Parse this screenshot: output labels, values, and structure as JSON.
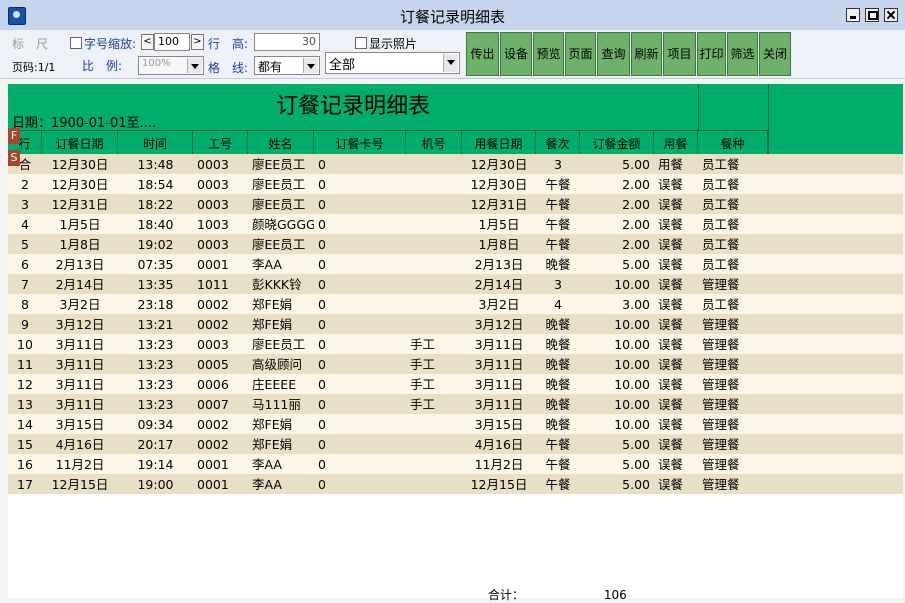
{
  "window": {
    "title": "订餐记录明细表"
  },
  "toolbar": {
    "ruler_label": "标　尺",
    "font_scale_label": "字号缩放:",
    "font_scale_value": "100",
    "row_label": "行",
    "height_label": "高:",
    "height_value": "30",
    "show_photo_label": "显示照片",
    "page_label": "页码:1/1",
    "ratio_label": "比　例:",
    "ratio_value": "100%",
    "grid_label": "格　线:",
    "grid_value": "都有",
    "scope_value": "全部",
    "buttons": [
      "传出",
      "设备",
      "预览",
      "页面",
      "查询",
      "刷新",
      "项目",
      "打印",
      "筛选",
      "关闭"
    ]
  },
  "report": {
    "title": "订餐记录明细表",
    "date_range": "日期：1900-01-01至....",
    "badges": [
      "F",
      "S"
    ],
    "columns": [
      "行",
      "订餐日期",
      "时间",
      "工号",
      "姓名",
      "订餐卡号",
      "机号",
      "用餐日期",
      "餐次",
      "订餐金额",
      "用餐",
      "餐种"
    ],
    "rows": [
      [
        "合",
        "12月30日",
        "13:48",
        "0003",
        "廖EE员工",
        "0",
        "",
        "12月30日",
        "3",
        "5.00",
        "用餐",
        "员工餐"
      ],
      [
        "2",
        "12月30日",
        "18:54",
        "0003",
        "廖EE员工",
        "0",
        "",
        "12月30日",
        "午餐",
        "2.00",
        "误餐",
        "员工餐"
      ],
      [
        "3",
        "12月31日",
        "18:22",
        "0003",
        "廖EE员工",
        "0",
        "",
        "12月31日",
        "午餐",
        "2.00",
        "误餐",
        "员工餐"
      ],
      [
        "4",
        "1月5日",
        "18:40",
        "1003",
        "颜晓GGGG",
        "0",
        "",
        "1月5日",
        "午餐",
        "2.00",
        "误餐",
        "员工餐"
      ],
      [
        "5",
        "1月8日",
        "19:02",
        "0003",
        "廖EE员工",
        "0",
        "",
        "1月8日",
        "午餐",
        "2.00",
        "误餐",
        "员工餐"
      ],
      [
        "6",
        "2月13日",
        "07:35",
        "0001",
        "李AA",
        "0",
        "",
        "2月13日",
        "晚餐",
        "5.00",
        "误餐",
        "员工餐"
      ],
      [
        "7",
        "2月14日",
        "13:35",
        "1011",
        "彭KKK铃",
        "0",
        "",
        "2月14日",
        "3",
        "10.00",
        "误餐",
        "管理餐"
      ],
      [
        "8",
        "3月2日",
        "23:18",
        "0002",
        "郑FE娟",
        "0",
        "",
        "3月2日",
        "4",
        "3.00",
        "误餐",
        "员工餐"
      ],
      [
        "9",
        "3月12日",
        "13:21",
        "0002",
        "郑FE娟",
        "0",
        "",
        "3月12日",
        "晚餐",
        "10.00",
        "误餐",
        "管理餐"
      ],
      [
        "10",
        "3月11日",
        "13:23",
        "0003",
        "廖EE员工",
        "0",
        "手工",
        "3月11日",
        "晚餐",
        "10.00",
        "误餐",
        "管理餐"
      ],
      [
        "11",
        "3月11日",
        "13:23",
        "0005",
        "高级顾问",
        "0",
        "手工",
        "3月11日",
        "晚餐",
        "10.00",
        "误餐",
        "管理餐"
      ],
      [
        "12",
        "3月11日",
        "13:23",
        "0006",
        "庄EEEE",
        "0",
        "手工",
        "3月11日",
        "晚餐",
        "10.00",
        "误餐",
        "管理餐"
      ],
      [
        "13",
        "3月11日",
        "13:23",
        "0007",
        "马111丽",
        "0",
        "手工",
        "3月11日",
        "晚餐",
        "10.00",
        "误餐",
        "管理餐"
      ],
      [
        "14",
        "3月15日",
        "09:34",
        "0002",
        "郑FE娟",
        "0",
        "",
        "3月15日",
        "晚餐",
        "10.00",
        "误餐",
        "管理餐"
      ],
      [
        "15",
        "4月16日",
        "20:17",
        "0002",
        "郑FE娟",
        "0",
        "",
        "4月16日",
        "午餐",
        "5.00",
        "误餐",
        "管理餐"
      ],
      [
        "16",
        "11月2日",
        "19:14",
        "0001",
        "李AA",
        "0",
        "",
        "11月2日",
        "午餐",
        "5.00",
        "误餐",
        "管理餐"
      ],
      [
        "17",
        "12月15日",
        "19:00",
        "0001",
        "李AA",
        "0",
        "",
        "12月15日",
        "午餐",
        "5.00",
        "误餐",
        "管理餐"
      ]
    ],
    "footer_total_label": "合计：",
    "footer_total_value": "106"
  }
}
